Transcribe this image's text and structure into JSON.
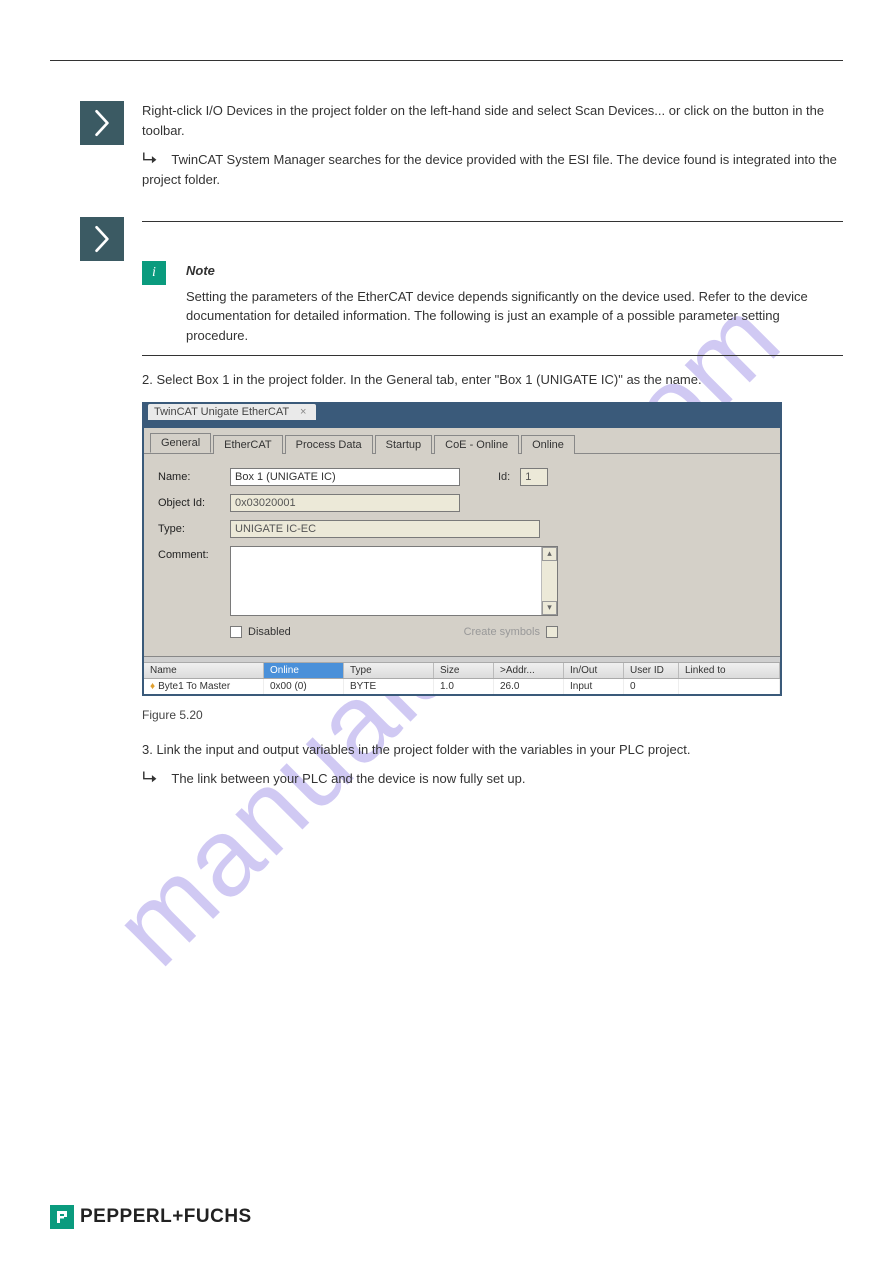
{
  "step1": {
    "text": "Right-click I/O Devices in the project folder on the left-hand side and select Scan Devices... or click on the button in the toolbar.",
    "result": "TwinCAT System Manager searches for the device provided with the ESI file. The device found is integrated into the project folder."
  },
  "step2": {
    "note_title": "Note",
    "note_body": "Setting the parameters of the EtherCAT device depends significantly on the device used. Refer to the device documentation for detailed information. The following is just an example of a possible parameter setting procedure.",
    "para1": "2. Select Box 1 in the project folder. In the General tab, enter \"Box 1 (UNIGATE IC)\" as the name.",
    "para2": "3. Link the input and output variables in the project folder with the variables in your PLC project.",
    "result": "The link between your PLC and the device is now fully set up."
  },
  "dialog": {
    "title": "TwinCAT Unigate EtherCAT",
    "tabs": [
      "General",
      "EtherCAT",
      "Process Data",
      "Startup",
      "CoE - Online",
      "Online"
    ],
    "fields": {
      "name_label": "Name:",
      "name_value": "Box 1 (UNIGATE IC)",
      "id_label": "Id:",
      "id_value": "1",
      "objid_label": "Object Id:",
      "objid_value": "0x03020001",
      "type_label": "Type:",
      "type_value": "UNIGATE IC-EC",
      "comment_label": "Comment:",
      "disabled_label": "Disabled",
      "create_symbols_label": "Create symbols"
    },
    "grid_headers": [
      "Name",
      "Online",
      "Type",
      "Size",
      ">Addr...",
      "In/Out",
      "User ID",
      "Linked to"
    ],
    "grid_row": {
      "name": "Byte1 To Master",
      "online": "0x00 (0)",
      "type": "BYTE",
      "size": "1.0",
      "addr": "26.0",
      "inout": "Input",
      "userid": "0",
      "linked": ""
    }
  },
  "figure_caption": "Figure 5.20",
  "footer_brand": "PEPPERL+FUCHS",
  "watermark": "manualshive.com"
}
